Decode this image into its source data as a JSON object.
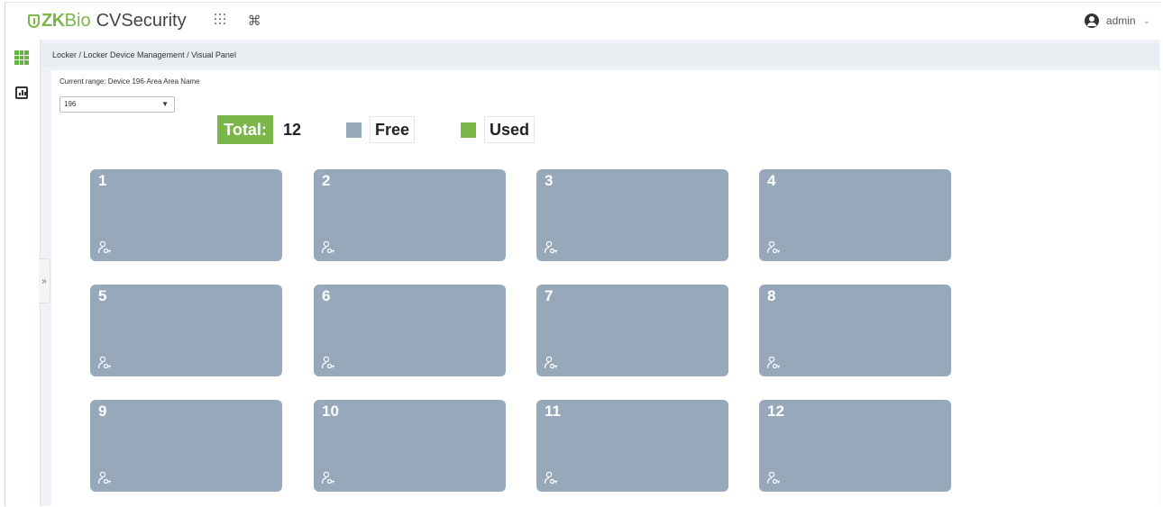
{
  "app": {
    "brand_zk": "ZK",
    "brand_bio": "Bio",
    "brand_name": "CVSecurity",
    "brand_color": "#7ab648"
  },
  "topbar": {
    "apps_icon": "apps-grid-icon",
    "command_icon": "command-icon",
    "user_name": "admin",
    "user_caret": "⌄"
  },
  "rail": {
    "items": [
      {
        "icon": "locker-grid-icon"
      },
      {
        "icon": "report-chart-icon"
      }
    ],
    "collapse_label": "»"
  },
  "breadcrumb": "Locker / Locker Device Management / Visual Panel",
  "range": {
    "label": "Current range: Device 196-Area Area Name",
    "selected": "196"
  },
  "legend": {
    "total_label": "Total:",
    "total_value": "12",
    "free_label": "Free",
    "used_label": "Used",
    "free_color": "#97a8ba",
    "used_color": "#7ab648"
  },
  "lockers": [
    {
      "number": "1",
      "status": "free"
    },
    {
      "number": "2",
      "status": "free"
    },
    {
      "number": "3",
      "status": "free"
    },
    {
      "number": "4",
      "status": "free"
    },
    {
      "number": "5",
      "status": "free"
    },
    {
      "number": "6",
      "status": "free"
    },
    {
      "number": "7",
      "status": "free"
    },
    {
      "number": "8",
      "status": "free"
    },
    {
      "number": "9",
      "status": "free"
    },
    {
      "number": "10",
      "status": "free"
    },
    {
      "number": "11",
      "status": "free"
    },
    {
      "number": "12",
      "status": "free"
    }
  ]
}
